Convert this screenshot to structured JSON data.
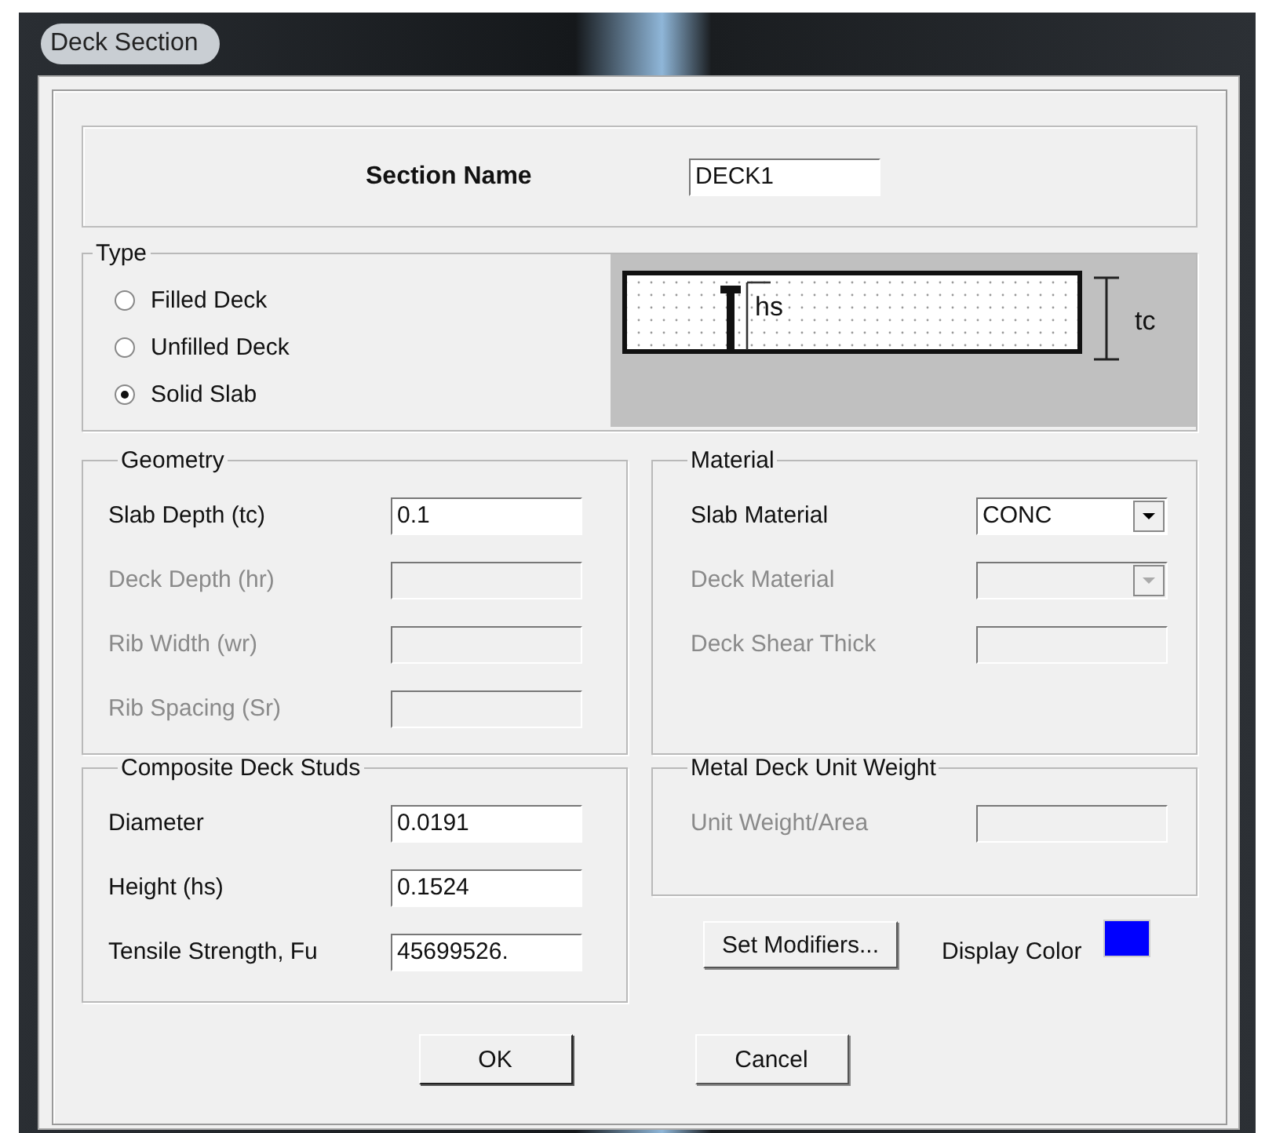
{
  "window": {
    "title": "Deck Section"
  },
  "section_name": {
    "label": "Section Name",
    "value": "DECK1"
  },
  "type": {
    "legend": "Type",
    "options": [
      {
        "label": "Filled Deck",
        "selected": false
      },
      {
        "label": "Unfilled Deck",
        "selected": false
      },
      {
        "label": "Solid Slab",
        "selected": true
      }
    ],
    "diagram": {
      "stud_label": "hs",
      "thickness_label": "tc"
    }
  },
  "geometry": {
    "legend": "Geometry",
    "fields": [
      {
        "kind": "text",
        "label": "Slab Depth (tc)",
        "value": "0.1",
        "disabled": false
      },
      {
        "kind": "text",
        "label": "Deck Depth (hr)",
        "disabled": true
      },
      {
        "kind": "text",
        "label": "Rib Width (wr)",
        "disabled": true
      },
      {
        "kind": "text",
        "label": "Rib Spacing (Sr)",
        "disabled": true
      }
    ]
  },
  "material": {
    "legend": "Material",
    "fields": [
      {
        "kind": "dropdown",
        "label": "Slab Material",
        "value": "CONC",
        "disabled": false
      },
      {
        "kind": "dropdown",
        "label": "Deck Material",
        "disabled": true
      },
      {
        "kind": "text",
        "label": "Deck Shear Thick",
        "disabled": true
      }
    ]
  },
  "studs": {
    "legend": "Composite Deck Studs",
    "fields": [
      {
        "kind": "text",
        "label": "Diameter",
        "value": "0.0191",
        "disabled": false
      },
      {
        "kind": "text",
        "label": "Height (hs)",
        "value": "0.1524",
        "disabled": false
      },
      {
        "kind": "text",
        "label": "Tensile Strength, Fu",
        "value": "45699526.",
        "disabled": false
      }
    ]
  },
  "unit_weight": {
    "legend": "Metal Deck Unit Weight",
    "fields": [
      {
        "kind": "text",
        "label": "Unit Weight/Area",
        "disabled": true
      }
    ]
  },
  "set_modifiers": "Set Modifiers...",
  "display_color": {
    "label": "Display Color",
    "color": "#0000ff"
  },
  "buttons": [
    "OK",
    "Cancel"
  ]
}
